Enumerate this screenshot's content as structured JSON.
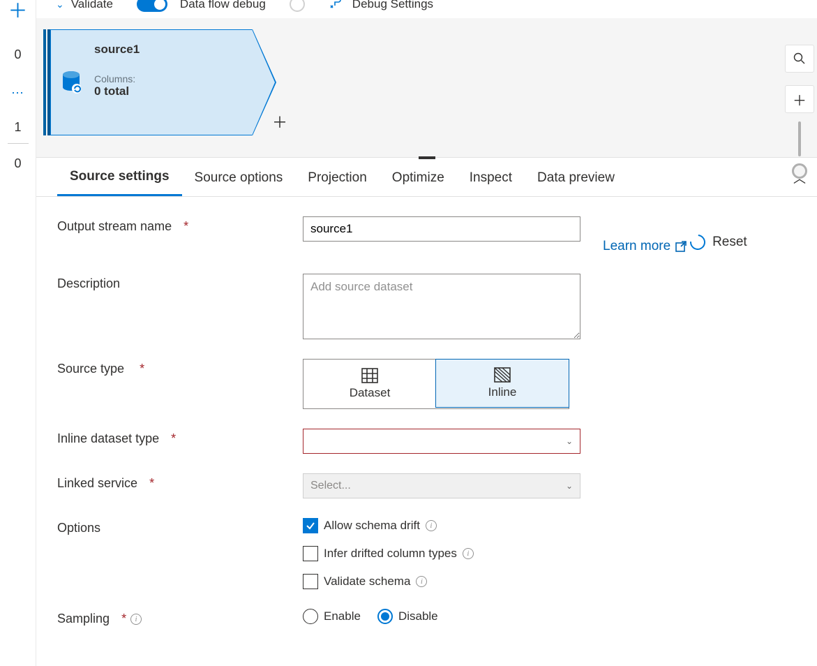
{
  "rail": {
    "items": [
      "0",
      "⋯",
      "1",
      "0"
    ]
  },
  "toolbar": {
    "validate": "Validate",
    "debug_toggle_label": "Data flow debug",
    "debug_settings": "Debug Settings"
  },
  "canvas": {
    "source_node": {
      "title": "source1",
      "columns_label": "Columns:",
      "columns_value": "0 total"
    }
  },
  "tabs": {
    "items": [
      "Source settings",
      "Source options",
      "Projection",
      "Optimize",
      "Inspect",
      "Data preview"
    ],
    "active_index": 0
  },
  "form": {
    "output_stream_label": "Output stream name",
    "output_stream_value": "source1",
    "description_label": "Description",
    "description_placeholder": "Add source dataset",
    "description_value": "",
    "source_type_label": "Source type",
    "source_type_options": [
      "Dataset",
      "Inline"
    ],
    "source_type_selected": "Inline",
    "inline_dataset_type_label": "Inline dataset type",
    "inline_dataset_type_value": "",
    "linked_service_label": "Linked service",
    "linked_service_placeholder": "Select...",
    "options_label": "Options",
    "options": {
      "allow_schema_drift": {
        "label": "Allow schema drift",
        "checked": true
      },
      "infer_drifted": {
        "label": "Infer drifted column types",
        "checked": false
      },
      "validate_schema": {
        "label": "Validate schema",
        "checked": false
      }
    },
    "sampling_label": "Sampling",
    "sampling_options": [
      "Enable",
      "Disable"
    ],
    "sampling_selected": "Disable"
  },
  "side": {
    "learn_more": "Learn more",
    "reset": "Reset"
  }
}
